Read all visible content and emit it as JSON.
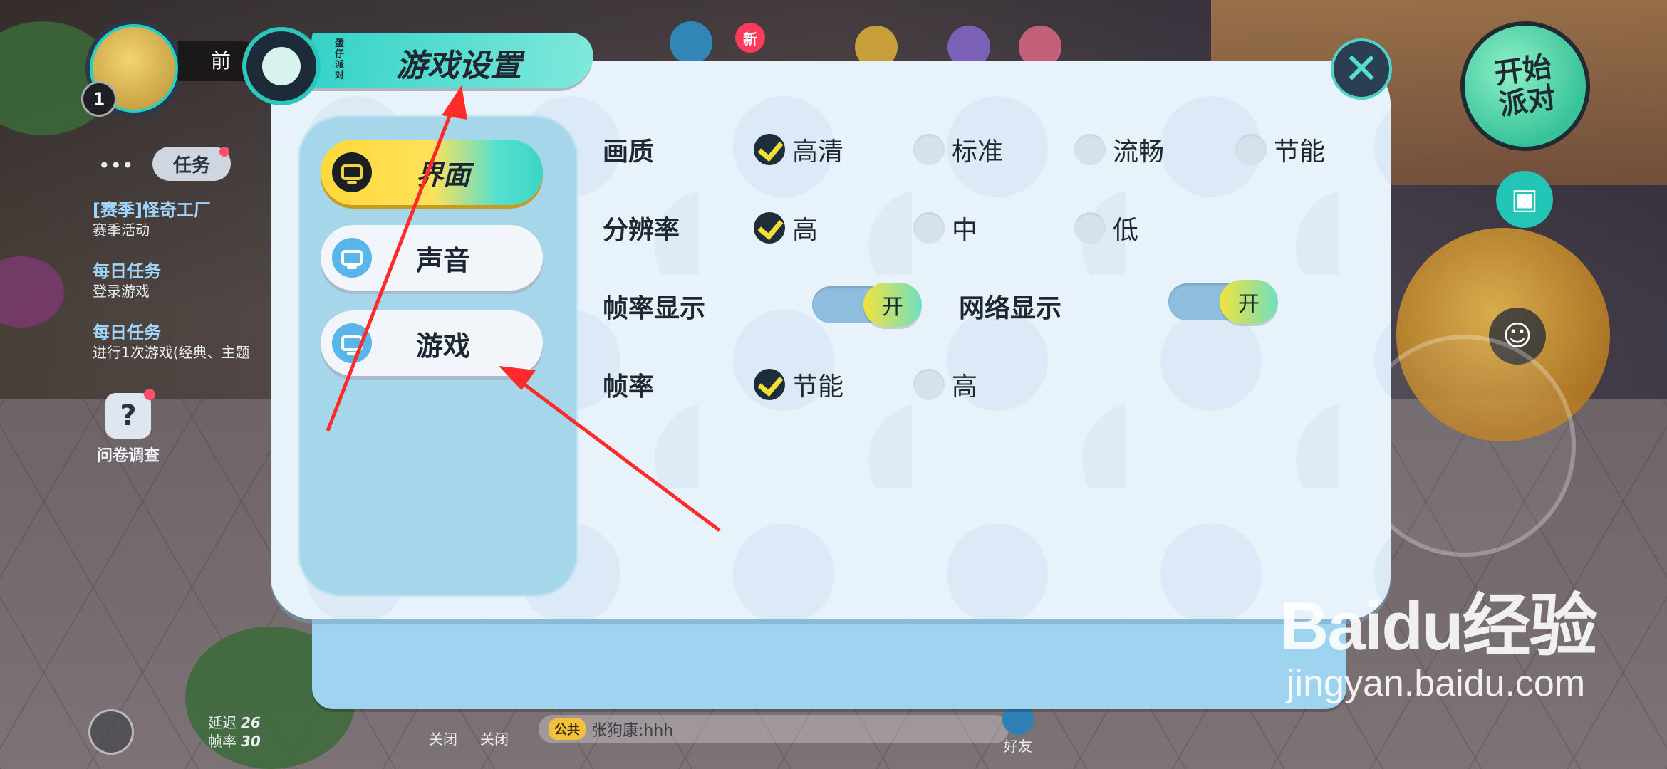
{
  "hud": {
    "player_level": "1",
    "player_name": "前",
    "task_tab_label": "任务",
    "tasks": [
      {
        "title": "[赛季]怪奇工厂",
        "desc": "赛季活动"
      },
      {
        "title": "每日任务",
        "desc": "登录游戏"
      },
      {
        "title": "每日任务",
        "desc": "进行1次游戏(经典、主题"
      }
    ],
    "survey_label": "问卷调查",
    "new_tag": "新",
    "start_party_label": "开始派对",
    "latency_label": "延迟",
    "latency_value": "26",
    "fps_label": "帧率",
    "fps_value": "30",
    "mic_left_label": "关闭",
    "speaker_label": "关闭",
    "chat_channel": "公共",
    "chat_message": "张狗康:hhh",
    "friends_label": "好友"
  },
  "settings": {
    "title": "游戏设置",
    "title_small": "蛋仔派对",
    "close_icon": "close-icon",
    "tabs": [
      {
        "label": "界面",
        "active": true
      },
      {
        "label": "声音",
        "active": false
      },
      {
        "label": "游戏",
        "active": false
      }
    ],
    "quality": {
      "label": "画质",
      "options": [
        {
          "label": "高清",
          "checked": true
        },
        {
          "label": "标准",
          "checked": false
        },
        {
          "label": "流畅",
          "checked": false
        },
        {
          "label": "节能",
          "checked": false
        }
      ]
    },
    "resolution": {
      "label": "分辨率",
      "options": [
        {
          "label": "高",
          "checked": true
        },
        {
          "label": "中",
          "checked": false
        },
        {
          "label": "低",
          "checked": false
        }
      ]
    },
    "fps_display": {
      "label": "帧率显示",
      "state": "开"
    },
    "network_display": {
      "label": "网络显示",
      "state": "开"
    },
    "frame_rate": {
      "label": "帧率",
      "options": [
        {
          "label": "节能",
          "checked": true
        },
        {
          "label": "高",
          "checked": false
        }
      ]
    }
  },
  "watermark": {
    "logo": "Baidu经验",
    "url": "jingyan.baidu.com"
  },
  "colors": {
    "accent_teal": "#34d2c8",
    "accent_yellow": "#ffd83a",
    "arrow_red": "#ff2a2a",
    "panel_bg": "#e8f2fb"
  }
}
